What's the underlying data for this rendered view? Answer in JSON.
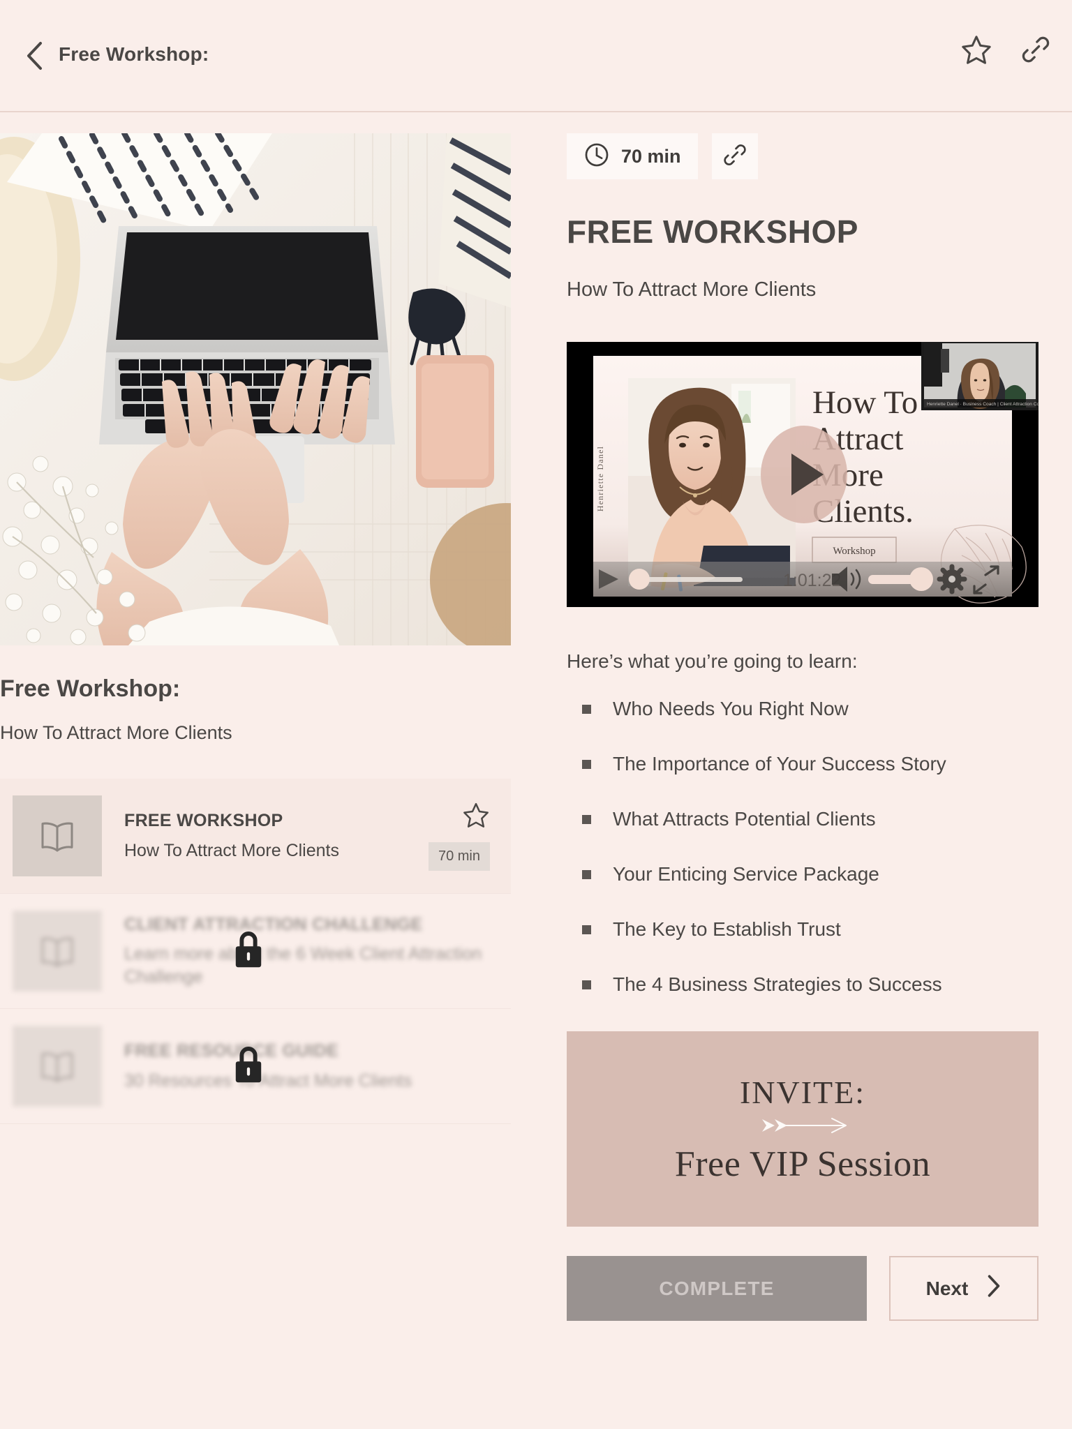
{
  "header": {
    "title": "Free Workshop:",
    "back_icon": "chevron-left-icon",
    "favorite_icon": "star-outline-icon",
    "share_icon": "link-icon"
  },
  "left": {
    "hero_alt": "flatlay-photo-hands-typing-on-laptop",
    "title": "Free Workshop:",
    "subtitle": "How To Attract More Clients",
    "lessons": [
      {
        "title": "FREE WORKSHOP",
        "desc": "How To Attract More Clients",
        "duration": "70 min",
        "locked": false,
        "favorited": false,
        "icon": "book-icon"
      },
      {
        "title": "CLIENT ATTRACTION CHALLENGE",
        "desc": "Learn more about the 6 Week Client Attraction Challenge",
        "duration": "",
        "locked": true,
        "favorited": false,
        "icon": "book-icon"
      },
      {
        "title": "FREE RESOURCE GUIDE",
        "desc": "30 Resources To Attract More Clients",
        "duration": "",
        "locked": true,
        "favorited": false,
        "icon": "book-icon"
      }
    ]
  },
  "right": {
    "duration_badge": "70 min",
    "clock_icon": "clock-icon",
    "copy_link_icon": "link-icon",
    "title": "FREE WORKSHOP",
    "subtitle": "How To Attract More Clients",
    "video": {
      "slide_title_lines": [
        "How To",
        "Attract",
        "More",
        "Clients."
      ],
      "presenter_vertical": "Henriette Danel",
      "slide_tag": "Workshop",
      "webcam_caption": "Henriette Danel  ·  Business Coach | Client Attraction Coach",
      "timestamp": "1:01:22",
      "play_icon": "play-icon",
      "volume_icon": "volume-icon",
      "settings_icon": "gear-icon",
      "fullscreen_icon": "expand-icon",
      "center_play_icon": "play-circle-icon",
      "progress_percent": 8,
      "volume_percent": 72
    },
    "learn_intro": "Here’s what you’re going to learn:",
    "learn_items": [
      "Who Needs You Right Now",
      "The Importance of Your Success Story",
      "What Attracts Potential Clients",
      "Your Enticing Service Package",
      "The Key to Establish Trust",
      "The 4 Business Strategies to Success"
    ],
    "invite": {
      "line1": "INVITE:",
      "line2": "Free VIP Session",
      "divider_icon": "arrow-right-icon",
      "bg_color": "#d7bcb3"
    },
    "complete_label": "COMPLETE",
    "next_label": "Next",
    "next_icon": "chevron-right-icon"
  },
  "theme": {
    "page_bg": "#faeeea",
    "text": "#4a4745",
    "accent": "#d7bcb3",
    "divider": "#e9d4cd",
    "disabled_btn": "#999290"
  }
}
